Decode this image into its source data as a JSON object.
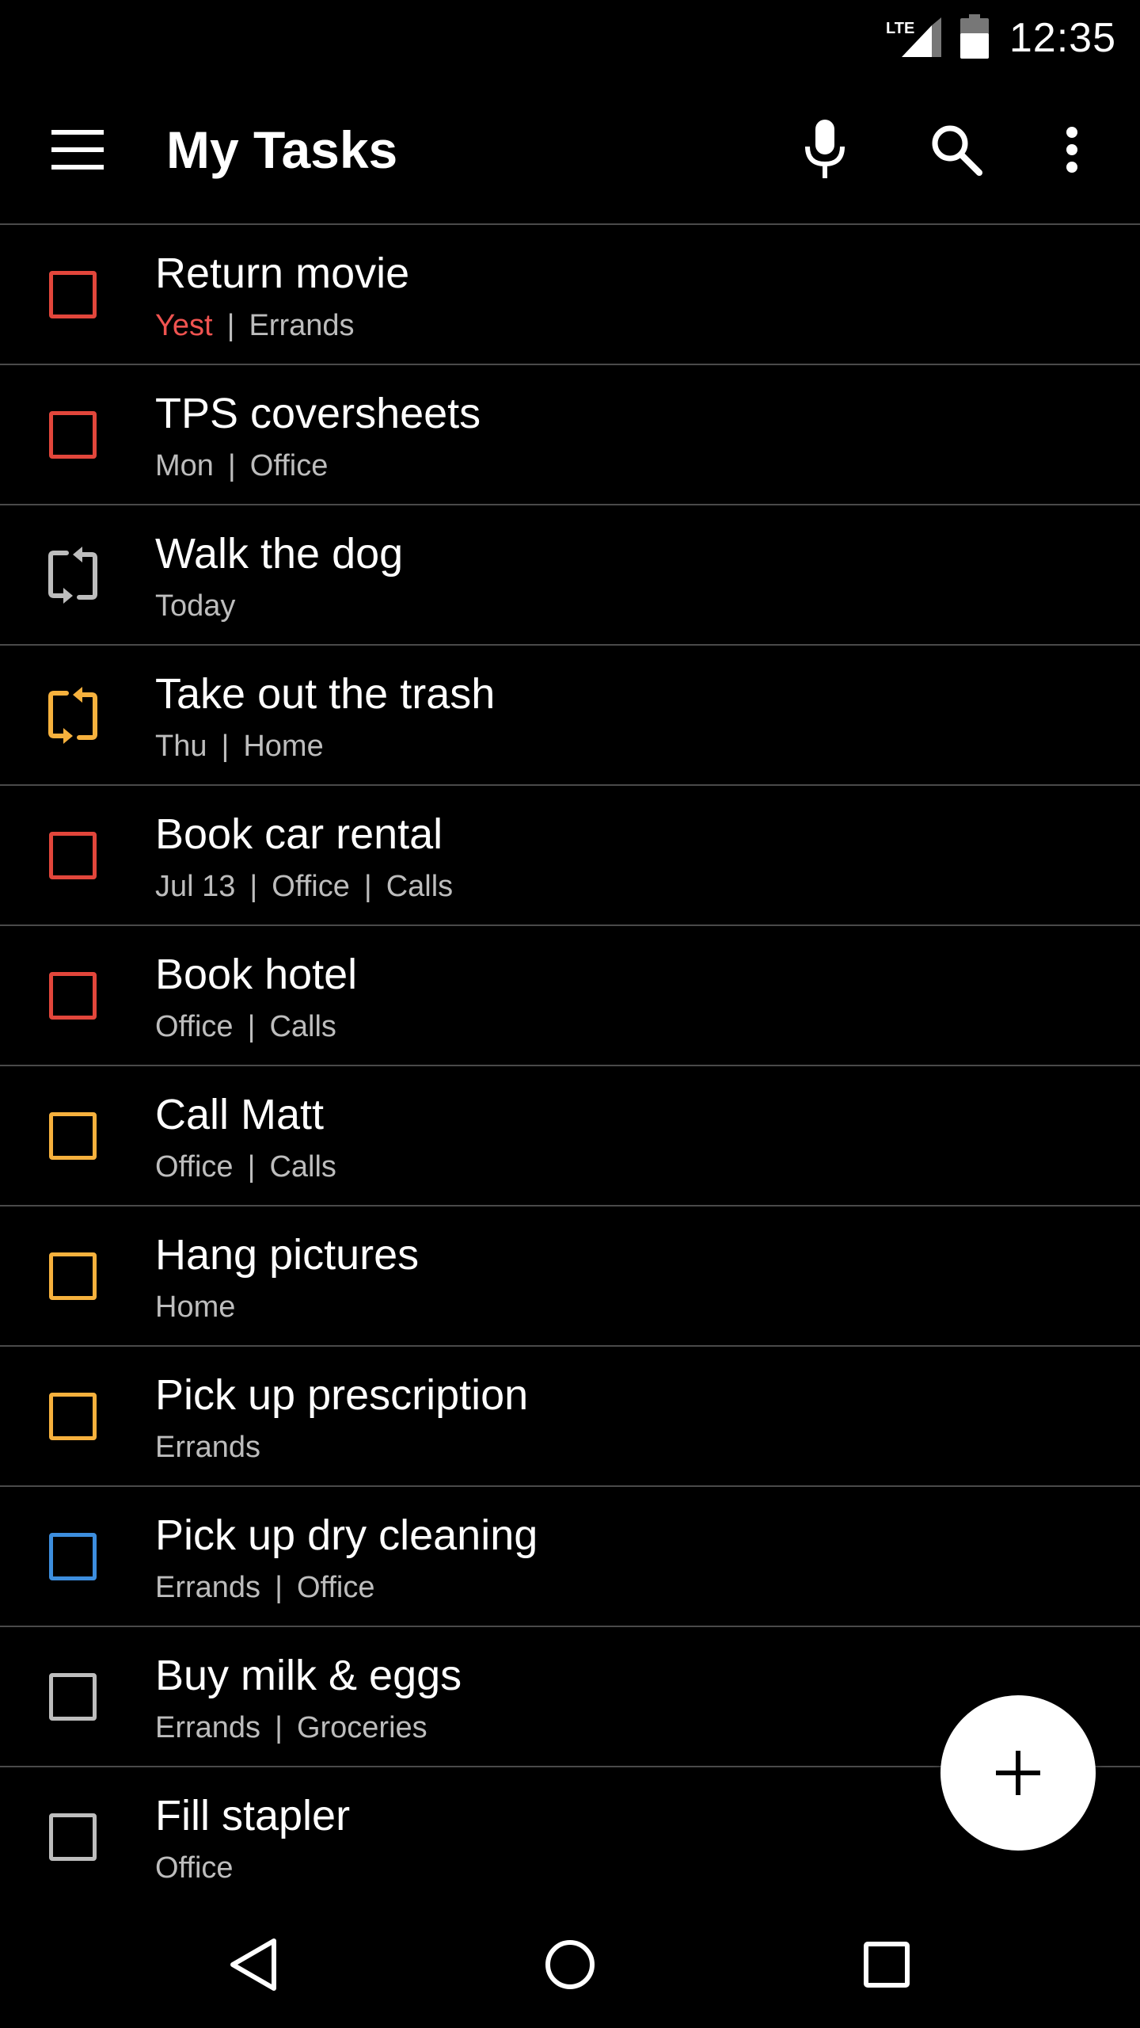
{
  "status_bar": {
    "network": "LTE",
    "time": "12:35"
  },
  "app_bar": {
    "title": "My Tasks",
    "icons": [
      "menu-icon",
      "mic-icon",
      "search-icon",
      "more-vert-icon"
    ]
  },
  "colors": {
    "background": "#000000",
    "divider": "#4a4a4a",
    "priority_red": "#e2463b",
    "priority_orange": "#f6b13d",
    "priority_blue": "#3d8ede",
    "priority_none": "#bdbdbd",
    "overdue_text": "#ef5350",
    "meta_text": "#bdbdbd"
  },
  "tasks": [
    {
      "title": "Return movie",
      "meta": [
        "Yest",
        "Errands"
      ],
      "overdue_first": true,
      "checkbox": "square",
      "priority": "red"
    },
    {
      "title": "TPS coversheets",
      "meta": [
        "Mon",
        "Office"
      ],
      "checkbox": "square",
      "priority": "red"
    },
    {
      "title": "Walk the dog",
      "meta": [
        "Today"
      ],
      "checkbox": "repeat",
      "priority": "none"
    },
    {
      "title": "Take out the trash",
      "meta": [
        "Thu",
        "Home"
      ],
      "checkbox": "repeat",
      "priority": "orange"
    },
    {
      "title": "Book car rental",
      "meta": [
        "Jul 13",
        "Office",
        "Calls"
      ],
      "checkbox": "square",
      "priority": "red"
    },
    {
      "title": "Book hotel",
      "meta": [
        "Office",
        "Calls"
      ],
      "checkbox": "square",
      "priority": "red"
    },
    {
      "title": "Call Matt",
      "meta": [
        "Office",
        "Calls"
      ],
      "checkbox": "square",
      "priority": "orange"
    },
    {
      "title": "Hang pictures",
      "meta": [
        "Home"
      ],
      "checkbox": "square",
      "priority": "orange"
    },
    {
      "title": "Pick up prescription",
      "meta": [
        "Errands"
      ],
      "checkbox": "square",
      "priority": "orange"
    },
    {
      "title": "Pick up dry cleaning",
      "meta": [
        "Errands",
        "Office"
      ],
      "checkbox": "square",
      "priority": "blue"
    },
    {
      "title": "Buy milk & eggs",
      "meta": [
        "Errands",
        "Groceries"
      ],
      "checkbox": "square",
      "priority": "none"
    },
    {
      "title": "Fill stapler",
      "meta": [
        "Office"
      ],
      "checkbox": "square",
      "priority": "none"
    }
  ],
  "fab": {
    "icon": "add-icon"
  },
  "nav_bar": {
    "icons": [
      "back-icon",
      "home-icon",
      "recents-icon"
    ]
  }
}
